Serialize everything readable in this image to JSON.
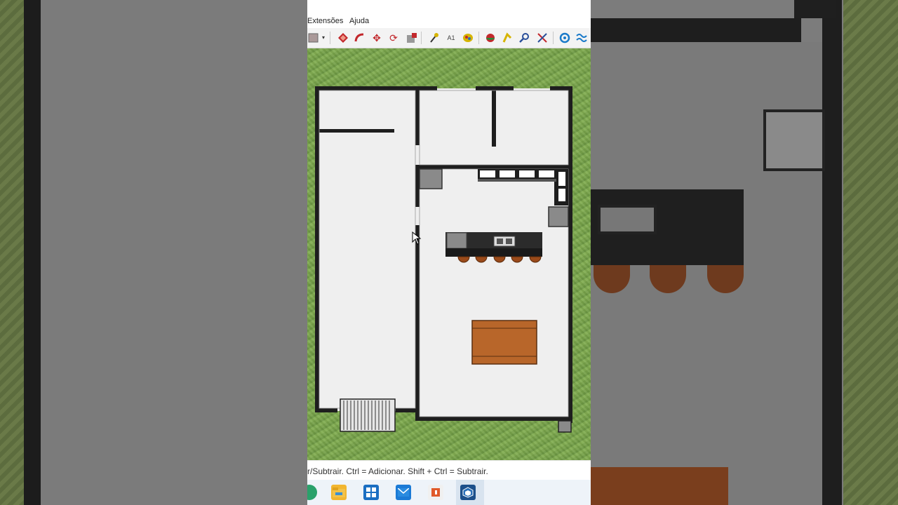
{
  "menu": {
    "extensions": "Extensões",
    "help": "Ajuda"
  },
  "toolbar": {
    "tools": [
      "paint-bucket-icon",
      "dropdown-arrow-icon",
      "push-pull-icon",
      "follow-me-icon",
      "move-icon",
      "rotate-icon",
      "scale-icon",
      "tape-measure-icon",
      "text-icon",
      "paint-icon",
      "orbit-icon",
      "walk-icon",
      "zoom-icon",
      "zoom-extents-icon",
      "section-plane-icon",
      "sandbox-icon"
    ]
  },
  "status": {
    "hint": "r/Subtrair. Ctrl = Adicionar. Shift + Ctrl = Subtrair."
  },
  "taskbar": {
    "apps": [
      "edge-icon",
      "file-explorer-icon",
      "store-icon",
      "mail-icon",
      "office-icon",
      "sketchup-icon"
    ]
  },
  "colors": {
    "grass": "#7aa54d",
    "floor": "#efefef",
    "wall": "#1e1e1e",
    "counter": "#2b2b2b",
    "stool": "#9a4a1a",
    "table": "#b8662a"
  }
}
